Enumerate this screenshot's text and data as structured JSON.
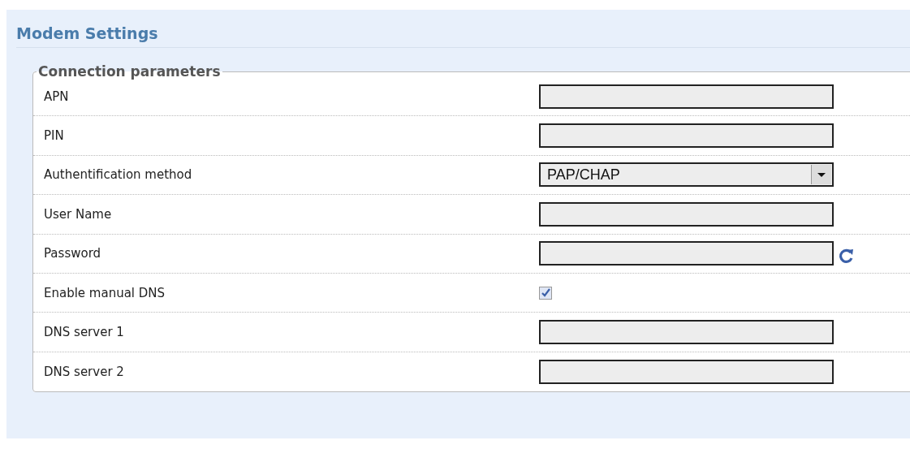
{
  "page": {
    "title": "Modem Settings"
  },
  "section": {
    "legend": "Connection parameters",
    "rows": [
      {
        "label": "APN",
        "kind": "text"
      },
      {
        "label": "PIN",
        "kind": "text"
      },
      {
        "label": "Authentification method",
        "kind": "select",
        "value": "PAP/CHAP"
      },
      {
        "label": "User Name",
        "kind": "text"
      },
      {
        "label": "Password",
        "kind": "password"
      },
      {
        "label": "Enable manual DNS",
        "kind": "checkbox",
        "checked": true
      },
      {
        "label": "DNS server 1",
        "kind": "text"
      },
      {
        "label": "DNS server 2",
        "kind": "text"
      }
    ]
  }
}
